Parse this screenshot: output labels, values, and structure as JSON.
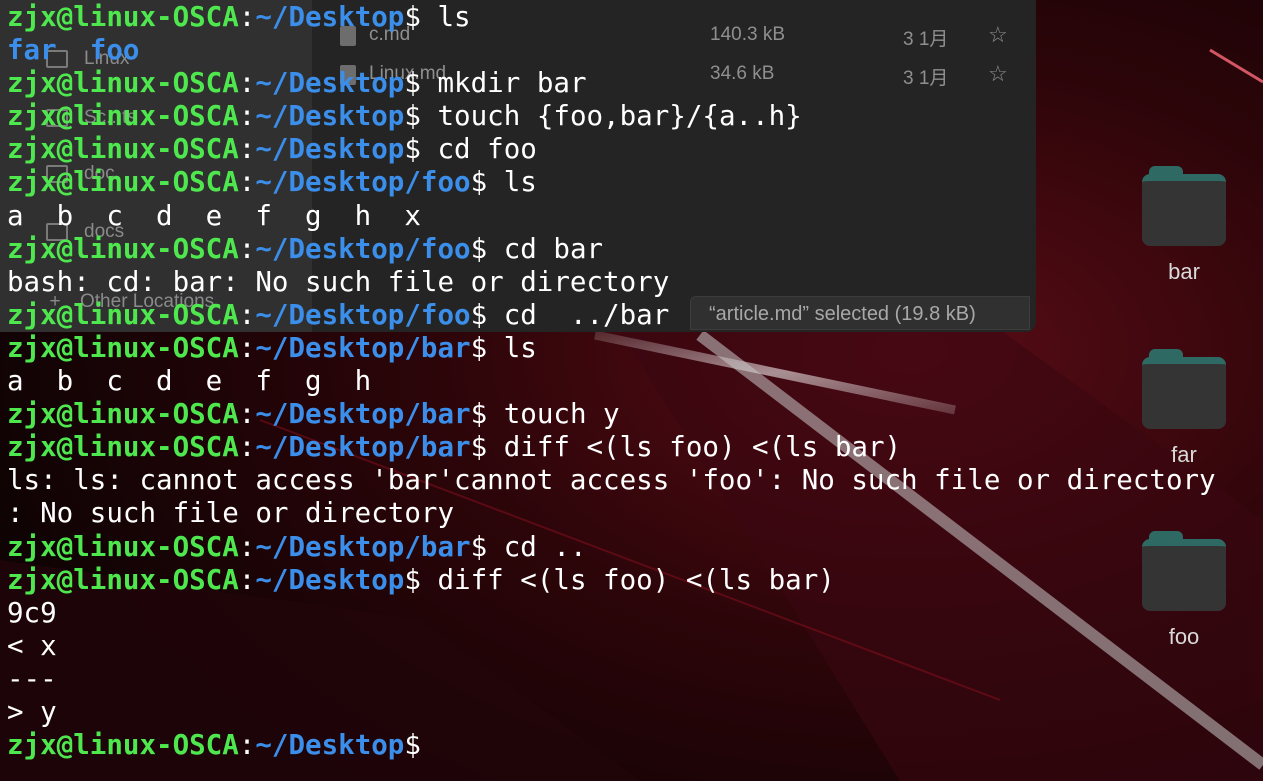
{
  "file_manager": {
    "sidebar": [
      {
        "label": "Linux"
      },
      {
        "label": "Sc...ts"
      },
      {
        "label": "doc"
      },
      {
        "label": "docs"
      },
      {
        "label": "Other Locations"
      }
    ],
    "files": [
      {
        "name": "c.md",
        "size": "140.3 kB",
        "date": "3 1月"
      },
      {
        "name": "Linux.md",
        "size": "34.6 kB",
        "date": "3 1月"
      }
    ],
    "status": "“article.md” selected  (19.8 kB)"
  },
  "desktop_icons": [
    {
      "label": "bar",
      "icon": "folder-icon"
    },
    {
      "label": "far",
      "icon": "folder-icon"
    },
    {
      "label": "foo",
      "icon": "folder-icon"
    }
  ],
  "terminal": {
    "prompt_user": "zjx@linux-OSCA",
    "lines": [
      {
        "type": "prompt",
        "path": "~/Desktop",
        "cmd": " ls"
      },
      {
        "type": "dirs",
        "text": "far  foo"
      },
      {
        "type": "prompt",
        "path": "~/Desktop",
        "cmd": " mkdir bar"
      },
      {
        "type": "prompt",
        "path": "~/Desktop",
        "cmd": " touch {foo,bar}/{a..h}"
      },
      {
        "type": "prompt",
        "path": "~/Desktop",
        "cmd": " cd foo"
      },
      {
        "type": "prompt",
        "path": "~/Desktop/foo",
        "cmd": " ls"
      },
      {
        "type": "output",
        "text": "a  b  c  d  e  f  g  h  x"
      },
      {
        "type": "prompt",
        "path": "~/Desktop/foo",
        "cmd": " cd bar"
      },
      {
        "type": "output",
        "text": "bash: cd: bar: No such file or directory"
      },
      {
        "type": "prompt",
        "path": "~/Desktop/foo",
        "cmd": " cd  ../bar"
      },
      {
        "type": "prompt",
        "path": "~/Desktop/bar",
        "cmd": " ls"
      },
      {
        "type": "output",
        "text": "a  b  c  d  e  f  g  h"
      },
      {
        "type": "prompt",
        "path": "~/Desktop/bar",
        "cmd": " touch y"
      },
      {
        "type": "prompt",
        "path": "~/Desktop/bar",
        "cmd": " diff <(ls foo) <(ls bar)"
      },
      {
        "type": "output",
        "text": "ls: ls: cannot access 'bar'cannot access 'foo': No such file or directory"
      },
      {
        "type": "output",
        "text": ": No such file or directory"
      },
      {
        "type": "prompt",
        "path": "~/Desktop/bar",
        "cmd": " cd .."
      },
      {
        "type": "prompt",
        "path": "~/Desktop",
        "cmd": " diff <(ls foo) <(ls bar)"
      },
      {
        "type": "output",
        "text": "9c9"
      },
      {
        "type": "output",
        "text": "< x"
      },
      {
        "type": "output",
        "text": "---"
      },
      {
        "type": "output",
        "text": "> y"
      },
      {
        "type": "prompt",
        "path": "~/Desktop",
        "cmd": ""
      }
    ]
  },
  "colors": {
    "prompt_user": "#4ee84e",
    "prompt_path": "#3b8eea",
    "text": "#ffffff",
    "folder_accent": "#2e6a63"
  }
}
